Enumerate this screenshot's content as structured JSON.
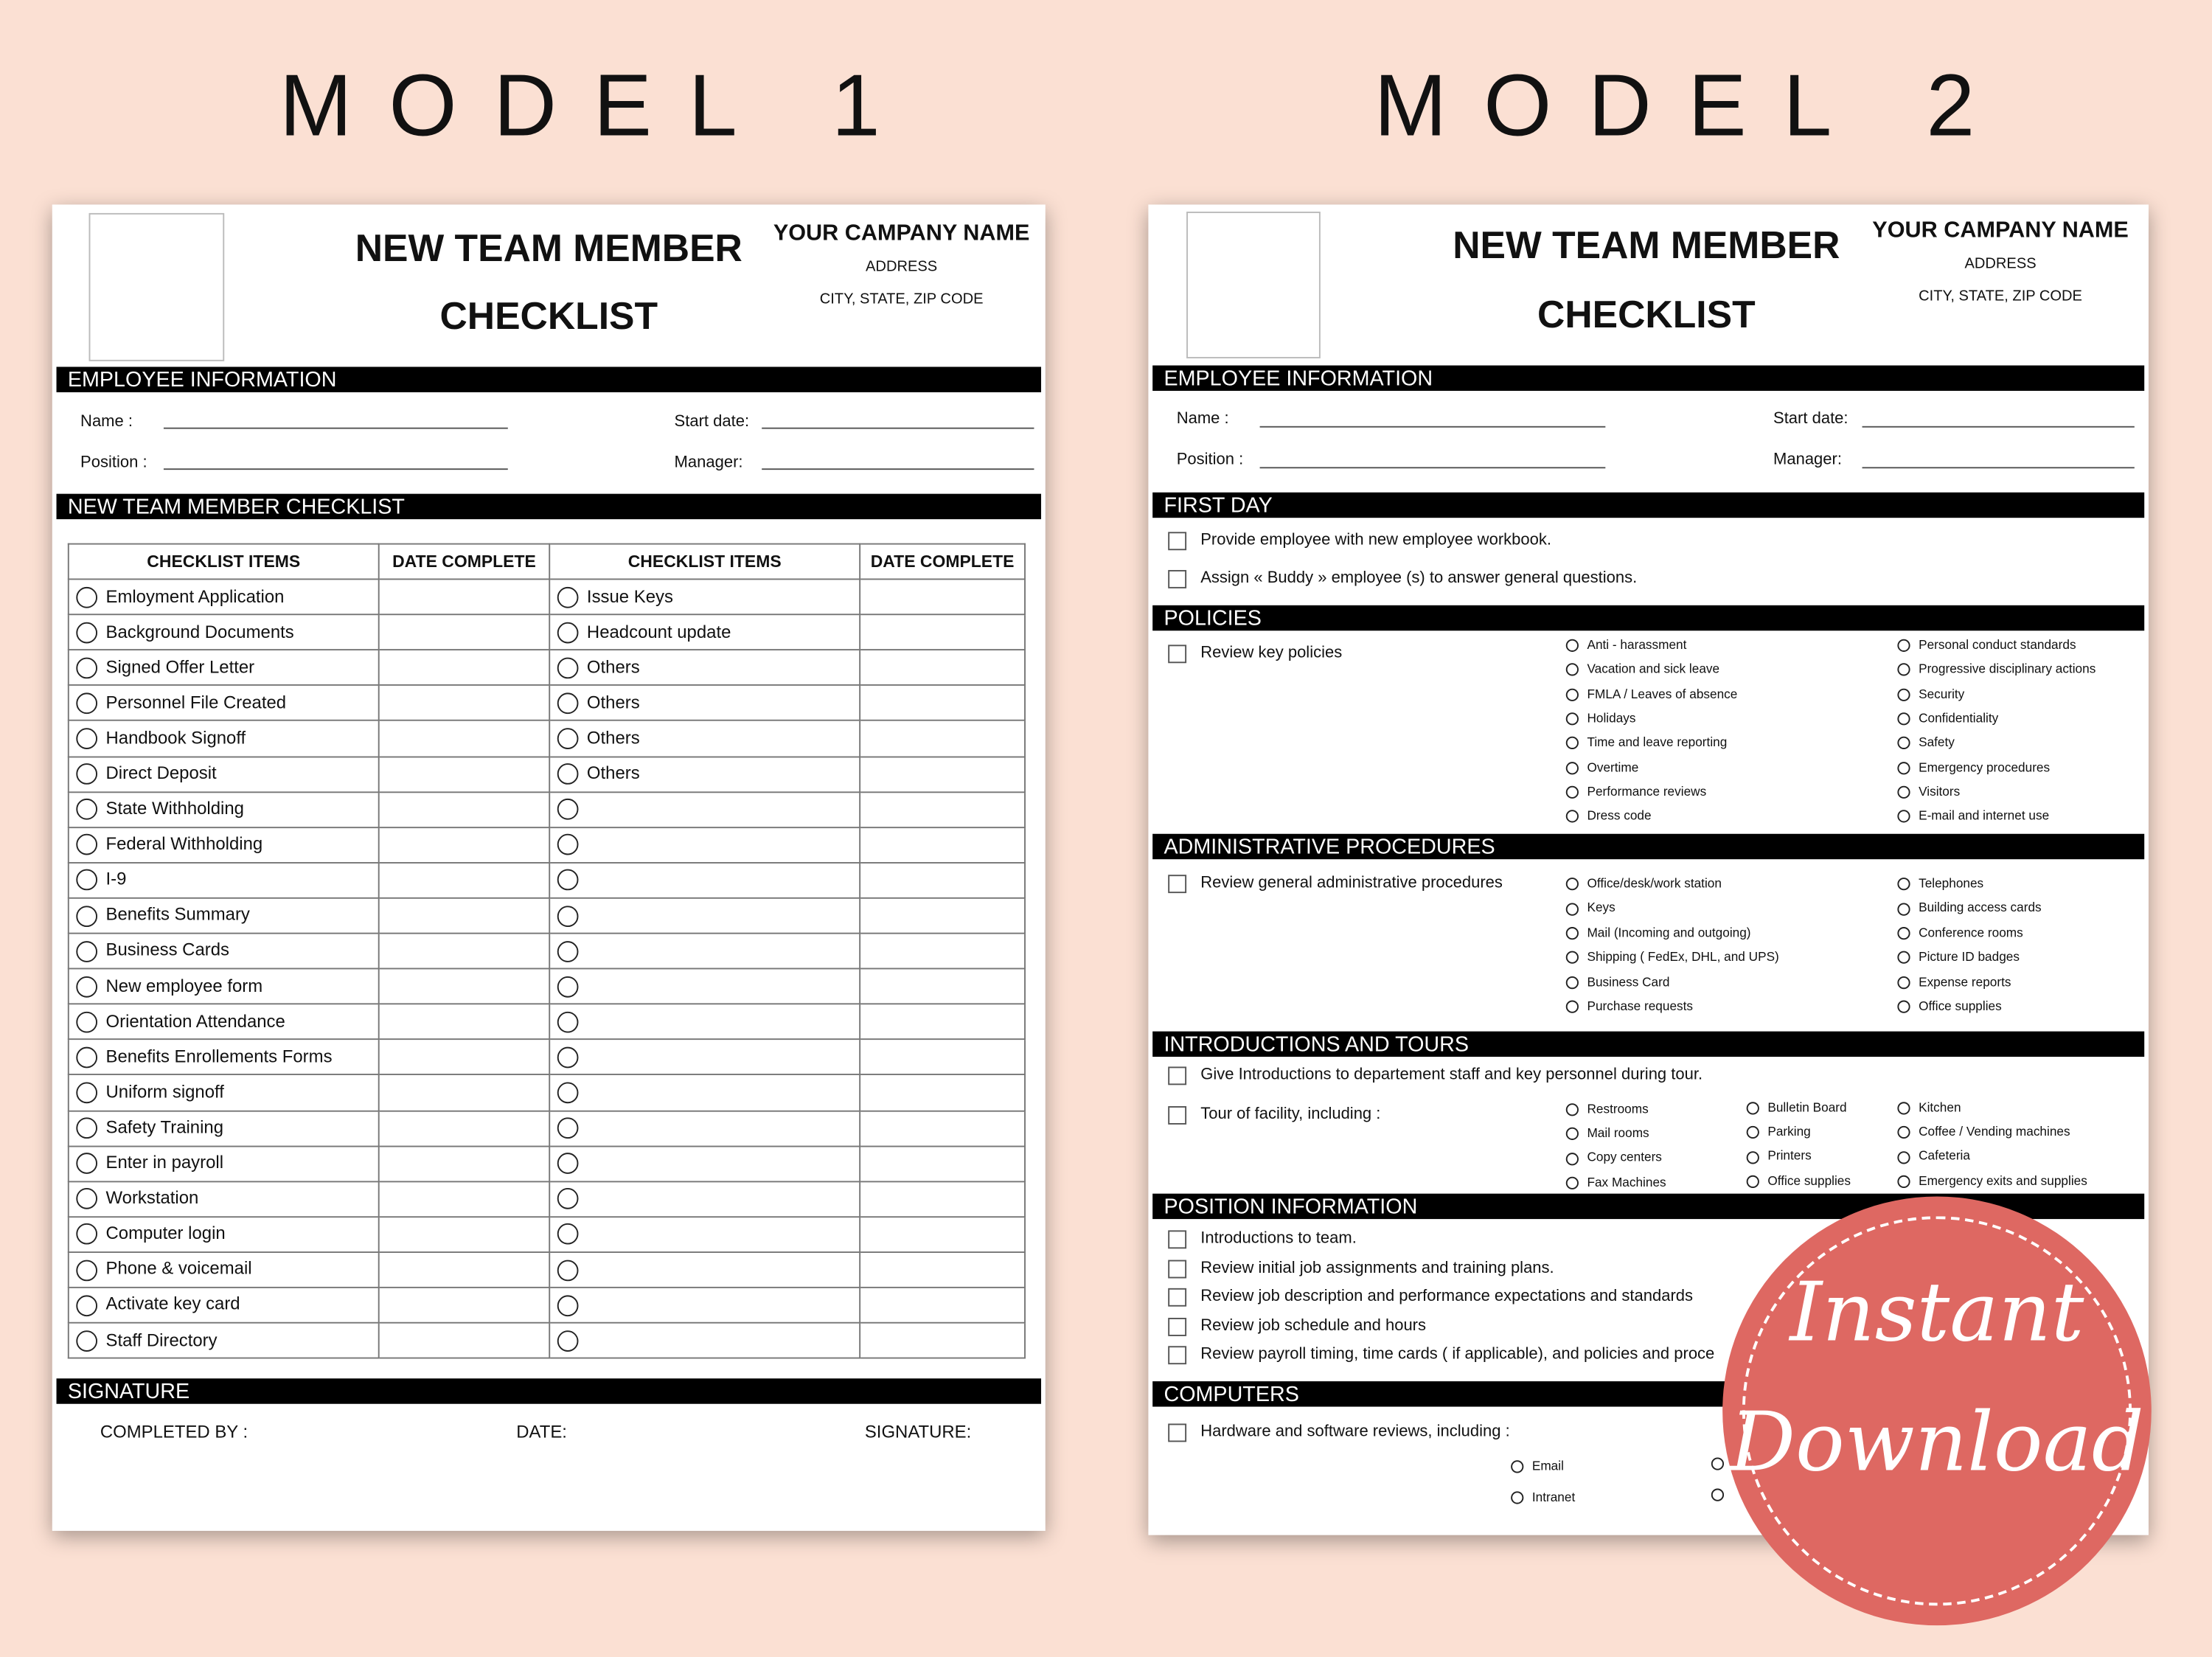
{
  "headings": {
    "model1": "MODEL 1",
    "model2": "MODEL 2"
  },
  "colors": {
    "background": "#fbe0d3",
    "badge": "#de6862",
    "section_bar": "#000000"
  },
  "model1": {
    "title_line1": "NEW TEAM MEMBER",
    "title_line2": "CHECKLIST",
    "company": {
      "name": "YOUR CAMPANY NAME",
      "address": "ADDRESS",
      "city": "CITY, STATE, ZIP CODE"
    },
    "employee_section": "EMPLOYEE INFORMATION",
    "fields": {
      "name": "Name :",
      "position": "Position :",
      "start_date": "Start date:",
      "manager": "Manager:"
    },
    "checklist_section": "NEW TEAM MEMBER CHECKLIST",
    "table_headers": [
      "CHECKLIST ITEMS",
      "DATE COMPLETE",
      "CHECKLIST ITEMS",
      "DATE COMPLETE"
    ],
    "left_items": [
      "Emloyment Application",
      "Background Documents",
      "Signed Offer Letter",
      "Personnel File Created",
      "Handbook Signoff",
      "Direct Deposit",
      "State Withholding",
      "Federal Withholding",
      "I-9",
      "Benefits Summary",
      "Business Cards",
      "New employee form",
      "Orientation Attendance",
      "Benefits Enrollements Forms",
      "Uniform signoff",
      "Safety Training",
      "Enter in payroll",
      "Workstation",
      "Computer login",
      "Phone & voicemail",
      "Activate key card",
      "Staff Directory"
    ],
    "right_items": [
      "Issue Keys",
      "Headcount update",
      "Others",
      "Others",
      "Others",
      "Others",
      "",
      "",
      "",
      "",
      "",
      "",
      "",
      "",
      "",
      "",
      "",
      "",
      "",
      "",
      "",
      ""
    ],
    "signature_section": "SIGNATURE",
    "signature": {
      "completed_by": "COMPLETED BY :",
      "date": "DATE:",
      "signature": "SIGNATURE:"
    }
  },
  "model2": {
    "title_line1": "NEW TEAM MEMBER",
    "title_line2": "CHECKLIST",
    "company": {
      "name": "YOUR CAMPANY NAME",
      "address": "ADDRESS",
      "city": "CITY, STATE, ZIP CODE"
    },
    "employee_section": "EMPLOYEE INFORMATION",
    "fields": {
      "name": "Name :",
      "position": "Position :",
      "start_date": "Start date:",
      "manager": "Manager:"
    },
    "first_day": {
      "title": "FIRST DAY",
      "items": [
        "Provide employee with new employee workbook.",
        "Assign « Buddy » employee (s) to answer general questions."
      ]
    },
    "policies": {
      "title": "POLICIES",
      "task": "Review key policies",
      "col1": [
        "Anti - harassment",
        "Vacation and sick leave",
        "FMLA / Leaves of absence",
        "Holidays",
        "Time and leave reporting",
        "Overtime",
        "Performance reviews",
        "Dress code"
      ],
      "col2": [
        "Personal conduct standards",
        "Progressive disciplinary actions",
        "Security",
        "Confidentiality",
        "Safety",
        "Emergency procedures",
        "Visitors",
        "E-mail and internet use"
      ]
    },
    "admin": {
      "title": "ADMINISTRATIVE PROCEDURES",
      "task": "Review general administrative procedures",
      "col1": [
        "Office/desk/work station",
        "Keys",
        "Mail (Incoming and outgoing)",
        "Shipping ( FedEx, DHL, and UPS)",
        "Business Card",
        "Purchase requests"
      ],
      "col2": [
        "Telephones",
        "Building access cards",
        "Conference rooms",
        "Picture ID badges",
        "Expense reports",
        "Office supplies"
      ]
    },
    "intro": {
      "title": "INTRODUCTIONS AND TOURS",
      "task1": "Give Introductions to departement staff and key personnel during tour.",
      "task2": "Tour of facility, including :",
      "col1": [
        "Restrooms",
        "Mail rooms",
        "Copy centers",
        "Fax Machines"
      ],
      "col2": [
        "Bulletin Board",
        "Parking",
        "Printers",
        "Office supplies"
      ],
      "col3": [
        "Kitchen",
        "Coffee / Vending machines",
        "Cafeteria",
        "Emergency exits and supplies"
      ]
    },
    "position": {
      "title": "POSITION INFORMATION",
      "items": [
        "Introductions to team.",
        "Review initial job assignments and training plans.",
        "Review job description and performance expectations and standards",
        "Review job schedule and hours",
        "Review payroll timing, time cards ( if applicable), and policies and proce"
      ]
    },
    "computers": {
      "title": "COMPUTERS",
      "task": "Hardware and software reviews, including :",
      "col1": [
        "Email",
        "Intranet"
      ]
    }
  },
  "badge": {
    "line1": "Instant",
    "line2": "Download"
  }
}
